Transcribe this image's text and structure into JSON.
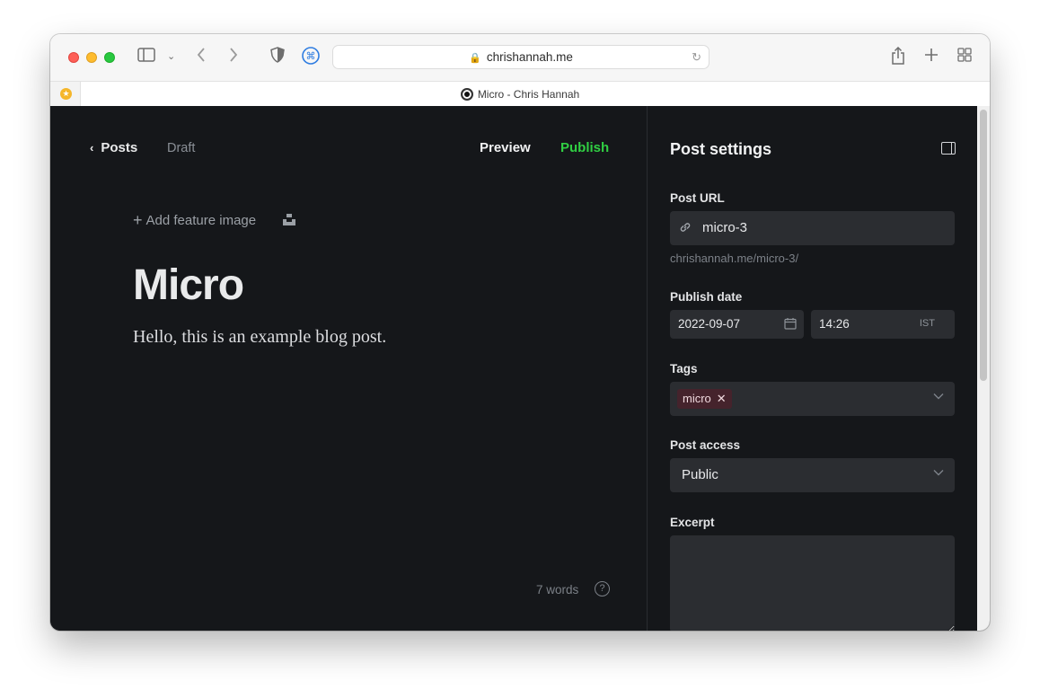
{
  "browser": {
    "address": "chrishannah.me",
    "tab_title": "Micro - Chris Hannah"
  },
  "editor": {
    "back_label": "Posts",
    "status": "Draft",
    "preview_label": "Preview",
    "publish_label": "Publish",
    "feature_image_label": "Add feature image",
    "title": "Micro",
    "body": "Hello, this is an example blog post.",
    "word_count": "7 words"
  },
  "settings": {
    "heading": "Post settings",
    "post_url_label": "Post URL",
    "post_url_value": "micro-3",
    "post_url_hint": "chrishannah.me/micro-3/",
    "publish_date_label": "Publish date",
    "date_value": "2022-09-07",
    "time_value": "14:26",
    "timezone": "IST",
    "tags_label": "Tags",
    "tags": [
      "micro"
    ],
    "access_label": "Post access",
    "access_value": "Public",
    "excerpt_label": "Excerpt",
    "excerpt_value": ""
  },
  "colors": {
    "publish_green": "#30cf43",
    "editor_bg": "#15171a",
    "field_bg": "#2b2d31",
    "tag_bg": "#45232c"
  },
  "icons": [
    "sidebar-icon",
    "back-icon",
    "forward-icon",
    "privacy-shield-icon",
    "extension-icon",
    "lock-icon",
    "reload-icon",
    "share-icon",
    "new-tab-icon",
    "tab-overview-icon",
    "link-icon",
    "calendar-icon",
    "close-icon",
    "chevron-down-icon",
    "help-icon",
    "settings-panel-icon",
    "unsplash-icon"
  ]
}
